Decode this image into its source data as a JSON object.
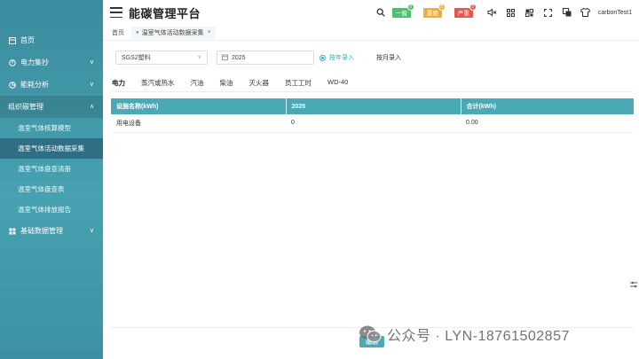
{
  "header": {
    "title": "能碳管理平台",
    "levels": [
      {
        "label": "一般",
        "count": "0",
        "color": "#4cbf70"
      },
      {
        "label": "重要",
        "count": "0",
        "color": "#f0ad3a"
      },
      {
        "label": "严重",
        "count": "0",
        "color": "#e5574c"
      }
    ],
    "username": "carbonTest1",
    "icons": [
      "search-icon",
      "mute-icon",
      "grid-icon",
      "qrcode-icon",
      "fullscreen-icon",
      "translate-icon",
      "shirt-icon"
    ]
  },
  "sidebar": {
    "items": [
      {
        "label": "首页",
        "icon": "home-icon",
        "arrow": ""
      },
      {
        "label": "电力集抄",
        "icon": "power-icon",
        "arrow": "∨"
      },
      {
        "label": "能耗分析",
        "icon": "chart-icon",
        "arrow": "∨"
      },
      {
        "label": "组织碳管理",
        "icon": "org-icon",
        "arrow": "∧"
      }
    ],
    "sub_items": [
      {
        "label": "温室气体核算模型"
      },
      {
        "label": "温室气体活动数据采集"
      },
      {
        "label": "温室气体盘查清册"
      },
      {
        "label": "温室气体盘查表"
      },
      {
        "label": "温室气体排放报告"
      }
    ],
    "bottom_item": {
      "label": "基础数据管理",
      "icon": "database-icon",
      "arrow": "∨"
    }
  },
  "tabbar": {
    "home": "首页",
    "open_tab": "温室气体活动数据采集",
    "close": "×"
  },
  "filters": {
    "org_select": "SGS2塑料",
    "year": "2025",
    "radio_year": "按年录入",
    "radio_month": "按月录入"
  },
  "categories": [
    "电力",
    "蒸汽或热水",
    "汽油",
    "柴油",
    "灭火器",
    "员工工时",
    "WD-40"
  ],
  "table": {
    "headers": [
      "设施名称(kWh)",
      "2025",
      "合计(kWh)"
    ],
    "rows": [
      [
        "用电设备",
        "0",
        "0.00"
      ]
    ]
  },
  "edit_button": "编辑",
  "watermark": "公众号 · LYN-18761502857"
}
